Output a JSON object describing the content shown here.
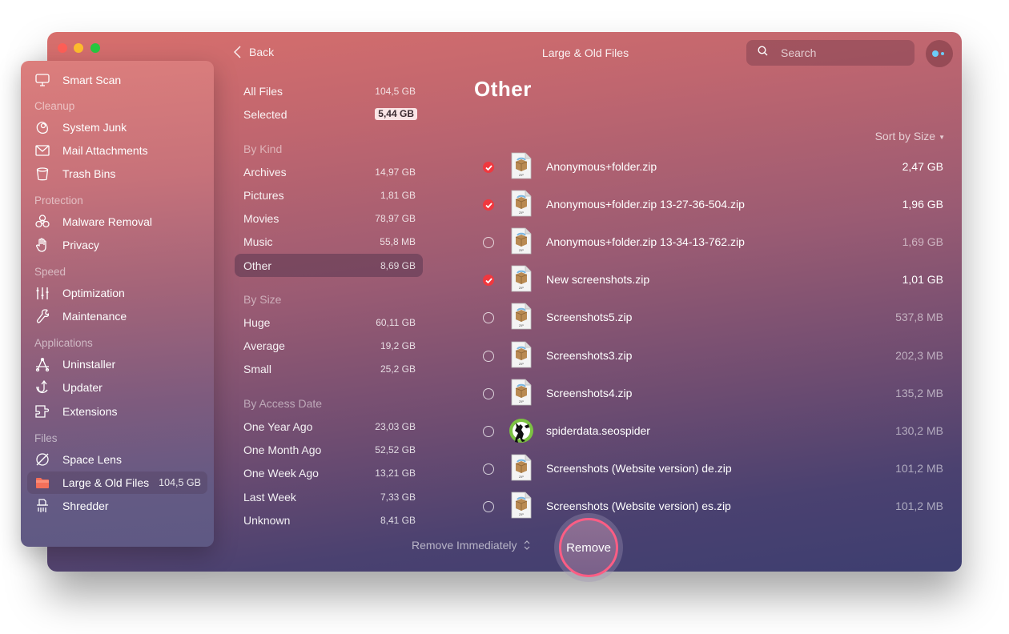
{
  "window": {
    "title": "Large & Old Files",
    "back_label": "Back"
  },
  "search": {
    "placeholder": "Search"
  },
  "sidebar": {
    "items": [
      {
        "label": "Smart Scan",
        "icon": "monitor-icon"
      },
      {
        "label": "System Junk",
        "icon": "system-junk-icon"
      },
      {
        "label": "Mail Attachments",
        "icon": "mail-icon"
      },
      {
        "label": "Trash Bins",
        "icon": "trash-icon"
      },
      {
        "label": "Malware Removal",
        "icon": "biohazard-icon"
      },
      {
        "label": "Privacy",
        "icon": "hand-icon"
      },
      {
        "label": "Optimization",
        "icon": "sliders-icon"
      },
      {
        "label": "Maintenance",
        "icon": "wrench-icon"
      },
      {
        "label": "Uninstaller",
        "icon": "uninstaller-icon"
      },
      {
        "label": "Updater",
        "icon": "updater-icon"
      },
      {
        "label": "Extensions",
        "icon": "puzzle-icon"
      },
      {
        "label": "Space Lens",
        "icon": "space-lens-icon"
      },
      {
        "label": "Large & Old Files",
        "icon": "folder-icon",
        "count": "104,5 GB"
      },
      {
        "label": "Shredder",
        "icon": "shredder-icon"
      }
    ],
    "sections": [
      "Cleanup",
      "Protection",
      "Speed",
      "Applications",
      "Files"
    ]
  },
  "categories": {
    "all_files": {
      "label": "All Files",
      "value": "104,5 GB"
    },
    "selected": {
      "label": "Selected",
      "value": "5,44 GB"
    },
    "by_kind": {
      "heading": "By Kind",
      "items": [
        {
          "label": "Archives",
          "value": "14,97 GB"
        },
        {
          "label": "Pictures",
          "value": "1,81 GB"
        },
        {
          "label": "Movies",
          "value": "78,97 GB"
        },
        {
          "label": "Music",
          "value": "55,8 MB"
        },
        {
          "label": "Other",
          "value": "8,69 GB"
        }
      ]
    },
    "by_size": {
      "heading": "By Size",
      "items": [
        {
          "label": "Huge",
          "value": "60,11 GB"
        },
        {
          "label": "Average",
          "value": "19,2 GB"
        },
        {
          "label": "Small",
          "value": "25,2 GB"
        }
      ]
    },
    "by_access": {
      "heading": "By Access Date",
      "items": [
        {
          "label": "One Year Ago",
          "value": "23,03 GB"
        },
        {
          "label": "One Month Ago",
          "value": "52,52 GB"
        },
        {
          "label": "One Week Ago",
          "value": "13,21 GB"
        },
        {
          "label": "Last Week",
          "value": "7,33 GB"
        },
        {
          "label": "Unknown",
          "value": "8,41 GB"
        }
      ]
    }
  },
  "main": {
    "title": "Other",
    "sort_label": "Sort by Size",
    "files": [
      {
        "name": "Anonymous+folder.zip",
        "size": "2,47 GB",
        "checked": true,
        "icon": "zip-file-icon"
      },
      {
        "name": "Anonymous+folder.zip 13-27-36-504.zip",
        "size": "1,96 GB",
        "checked": true,
        "icon": "zip-file-icon"
      },
      {
        "name": "Anonymous+folder.zip 13-34-13-762.zip",
        "size": "1,69 GB",
        "checked": false,
        "icon": "zip-file-icon"
      },
      {
        "name": "New screenshots.zip",
        "size": "1,01 GB",
        "checked": true,
        "icon": "zip-file-icon"
      },
      {
        "name": "Screenshots5.zip",
        "size": "537,8 MB",
        "checked": false,
        "icon": "zip-file-icon"
      },
      {
        "name": "Screenshots3.zip",
        "size": "202,3 MB",
        "checked": false,
        "icon": "zip-file-icon"
      },
      {
        "name": "Screenshots4.zip",
        "size": "135,2 MB",
        "checked": false,
        "icon": "zip-file-icon"
      },
      {
        "name": "spiderdata.seospider",
        "size": "130,2 MB",
        "checked": false,
        "icon": "seospider-frog-icon"
      },
      {
        "name": "Screenshots (Website version) de.zip",
        "size": "101,2 MB",
        "checked": false,
        "icon": "zip-file-icon"
      },
      {
        "name": "Screenshots (Website version) es.zip",
        "size": "101,2 MB",
        "checked": false,
        "icon": "zip-file-icon"
      }
    ]
  },
  "footer": {
    "remove_mode": "Remove Immediately",
    "remove_label": "Remove"
  },
  "colors": {
    "accent_check": "#f0383f",
    "remove_ring": "#fb5d84",
    "assistant_dot": "#6ccdf8"
  }
}
